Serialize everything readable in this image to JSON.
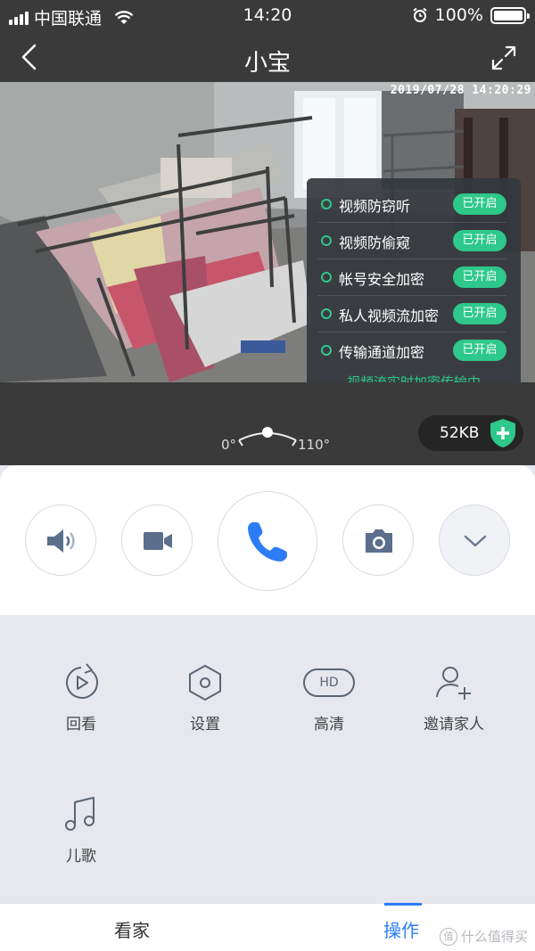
{
  "status_bar": {
    "carrier": "中国联通",
    "time": "14:20",
    "battery_text": "100%"
  },
  "nav": {
    "title": "小宝"
  },
  "video": {
    "timestamp": "2019/07/28 14:20:29",
    "security": {
      "items": [
        {
          "label": "视频防窃听",
          "status": "已开启"
        },
        {
          "label": "视频防偷窥",
          "status": "已开启"
        },
        {
          "label": "帐号安全加密",
          "status": "已开启"
        },
        {
          "label": "私人视频流加密",
          "status": "已开启"
        },
        {
          "label": "传输通道加密",
          "status": "已开启"
        }
      ],
      "footer": "视频流实时加密传输中"
    }
  },
  "angle": {
    "min": "0°",
    "max": "110°"
  },
  "data_rate": "52KB",
  "grid": {
    "items": [
      {
        "label": "回看",
        "icon": "replay-icon"
      },
      {
        "label": "设置",
        "icon": "settings-hexagon-icon"
      },
      {
        "label": "高清",
        "icon": "hd-icon"
      },
      {
        "label": "邀请家人",
        "icon": "add-person-icon"
      },
      {
        "label": "儿歌",
        "icon": "music-note-icon"
      }
    ],
    "hd_text": "HD"
  },
  "tabs": [
    {
      "label": "看家",
      "active": false
    },
    {
      "label": "操作",
      "active": true
    }
  ],
  "watermark": {
    "text": "什么值得买",
    "badge": "值"
  },
  "colors": {
    "accent": "#2c7cf6",
    "secure_green": "#2ec88a",
    "dark_bg": "#3a3a3a"
  }
}
